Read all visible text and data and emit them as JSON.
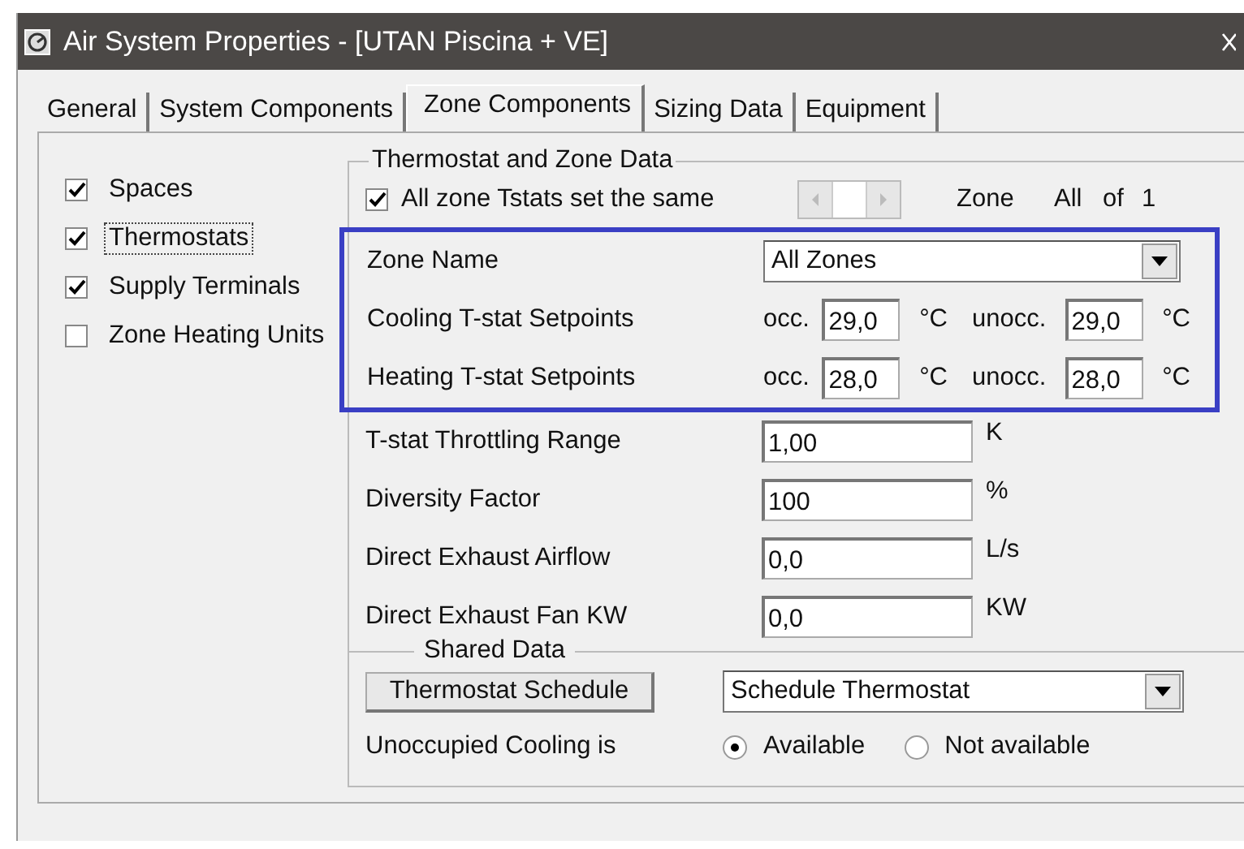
{
  "window": {
    "title": "Air System Properties - [UTAN Piscina + VE]"
  },
  "tabs": [
    {
      "label": "General",
      "selected": false
    },
    {
      "label": "System Components",
      "selected": false
    },
    {
      "label": "Zone Components",
      "selected": true
    },
    {
      "label": "Sizing Data",
      "selected": false
    },
    {
      "label": "Equipment",
      "selected": false
    }
  ],
  "components": [
    {
      "label": "Spaces",
      "checked": true,
      "focused": false
    },
    {
      "label": "Thermostats",
      "checked": true,
      "focused": true
    },
    {
      "label": "Supply Terminals",
      "checked": true,
      "focused": false
    },
    {
      "label": "Zone Heating Units",
      "checked": false,
      "focused": false
    }
  ],
  "thermostat_group": {
    "title": "Thermostat and Zone Data",
    "same_tstats": {
      "label": "All zone Tstats set the same",
      "checked": true
    },
    "zone_nav": {
      "label": "Zone",
      "value": "All",
      "of": "of",
      "count": "1"
    },
    "zone_name": {
      "label": "Zone Name",
      "value": "All Zones"
    },
    "setpoints": [
      {
        "label": "Cooling T-stat Setpoints",
        "occ_label": "occ.",
        "occ_value": "29,0",
        "occ_unit": "°C",
        "unocc_label": "unocc.",
        "unocc_value": "29,0",
        "unocc_unit": "°C"
      },
      {
        "label": "Heating T-stat Setpoints",
        "occ_label": "occ.",
        "occ_value": "28,0",
        "occ_unit": "°C",
        "unocc_label": "unocc.",
        "unocc_value": "28,0",
        "unocc_unit": "°C"
      }
    ],
    "fields": [
      {
        "label": "T-stat Throttling Range",
        "value": "1,00",
        "unit": "K"
      },
      {
        "label": "Diversity Factor",
        "value": "100",
        "unit": "%"
      },
      {
        "label": "Direct Exhaust Airflow",
        "value": "0,0",
        "unit": "L/s"
      },
      {
        "label": "Direct Exhaust Fan KW",
        "value": "0,0",
        "unit": "KW"
      }
    ]
  },
  "shared_data": {
    "title": "Shared Data",
    "schedule_button": "Thermostat Schedule",
    "schedule_value": "Schedule Thermostat",
    "unoccupied_cooling": {
      "label": "Unoccupied Cooling is",
      "options": [
        {
          "label": "Available",
          "selected": true
        },
        {
          "label": "Not available",
          "selected": false
        }
      ]
    }
  }
}
